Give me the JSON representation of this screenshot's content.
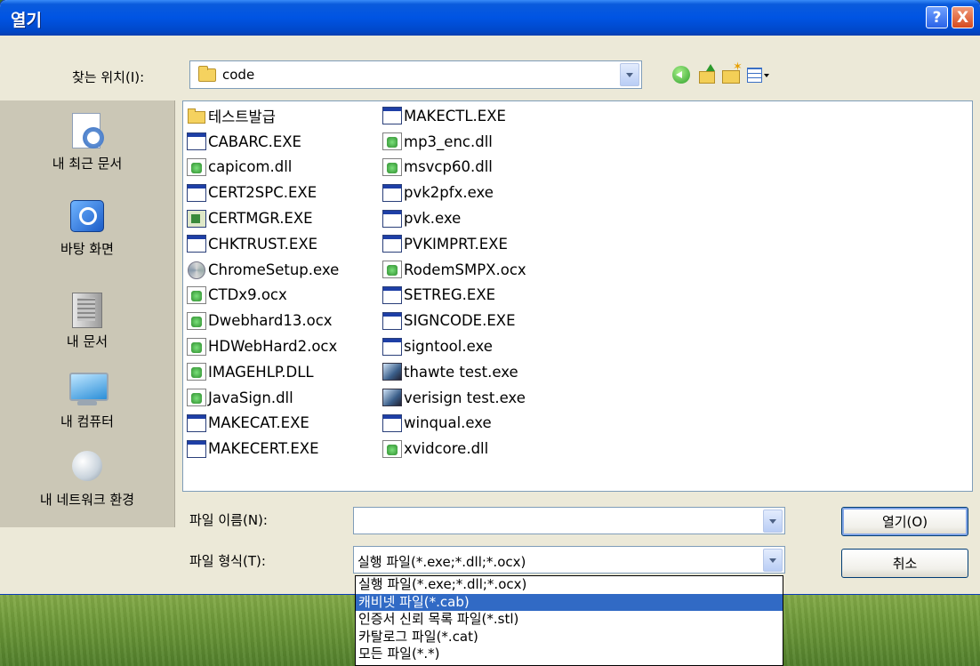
{
  "window": {
    "title": "열기",
    "help_label": "?",
    "close_label": "X"
  },
  "toolbar": {
    "look_in_label": "찾는 위치(I):",
    "look_in_value": "code"
  },
  "places": [
    {
      "label": "내 최근 문서",
      "icon": "recent-documents-icon"
    },
    {
      "label": "바탕 화면",
      "icon": "desktop-icon"
    },
    {
      "label": "내 문서",
      "icon": "my-documents-icon"
    },
    {
      "label": "내 컴퓨터",
      "icon": "my-computer-icon"
    },
    {
      "label": "내 네트워크 환경",
      "icon": "network-icon"
    }
  ],
  "files": {
    "column1": [
      {
        "name": "테스트발급",
        "type": "folder"
      },
      {
        "name": "CABARC.EXE",
        "type": "exe"
      },
      {
        "name": "capicom.dll",
        "type": "dll"
      },
      {
        "name": "CERT2SPC.EXE",
        "type": "exe"
      },
      {
        "name": "CERTMGR.EXE",
        "type": "cert"
      },
      {
        "name": "CHKTRUST.EXE",
        "type": "exe"
      },
      {
        "name": "ChromeSetup.exe",
        "type": "setup"
      },
      {
        "name": "CTDx9.ocx",
        "type": "dll"
      },
      {
        "name": "Dwebhard13.ocx",
        "type": "dll"
      },
      {
        "name": "HDWebHard2.ocx",
        "type": "dll"
      },
      {
        "name": "IMAGEHLP.DLL",
        "type": "dll"
      },
      {
        "name": "JavaSign.dll",
        "type": "dll"
      },
      {
        "name": "MAKECAT.EXE",
        "type": "exe"
      },
      {
        "name": "MAKECERT.EXE",
        "type": "exe"
      }
    ],
    "column2": [
      {
        "name": "MAKECTL.EXE",
        "type": "exe"
      },
      {
        "name": "mp3_enc.dll",
        "type": "dll"
      },
      {
        "name": "msvcp60.dll",
        "type": "dll"
      },
      {
        "name": "pvk2pfx.exe",
        "type": "exe"
      },
      {
        "name": "pvk.exe",
        "type": "exe"
      },
      {
        "name": "PVKIMPRT.EXE",
        "type": "exe"
      },
      {
        "name": "RodemSMPX.ocx",
        "type": "dll"
      },
      {
        "name": "SETREG.EXE",
        "type": "exe"
      },
      {
        "name": "SIGNCODE.EXE",
        "type": "exe"
      },
      {
        "name": "signtool.exe",
        "type": "exe"
      },
      {
        "name": "thawte test.exe",
        "type": "photo"
      },
      {
        "name": "verisign test.exe",
        "type": "photo"
      },
      {
        "name": "winqual.exe",
        "type": "exe"
      },
      {
        "name": "xvidcore.dll",
        "type": "dll"
      }
    ]
  },
  "form": {
    "filename_label": "파일 이름(N):",
    "filename_value": "",
    "filetype_label": "파일 형식(T):",
    "filetype_value": "실행 파일(*.exe;*.dll;*.ocx)",
    "open_button": "열기(O)",
    "cancel_button": "취소"
  },
  "filetype_options": [
    "실행 파일(*.exe;*.dll;*.ocx)",
    "캐비넷 파일(*.cab)",
    "인증서 신뢰 목록 파일(*.stl)",
    "카탈로그 파일(*.cat)",
    "모든 파일(*.*)"
  ],
  "filetype_selected_index": 1
}
